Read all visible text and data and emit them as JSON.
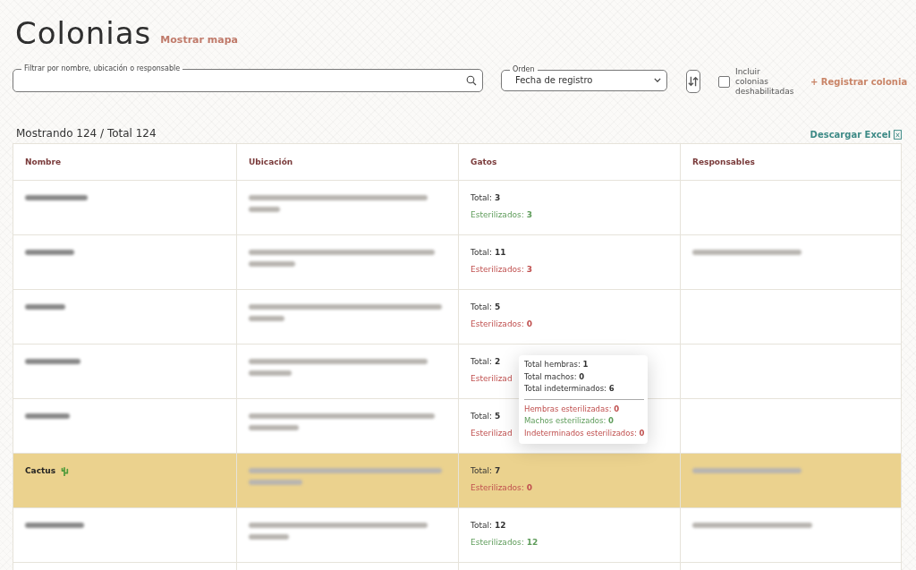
{
  "header": {
    "title": "Colonias",
    "map_link": "Mostrar mapa"
  },
  "filters": {
    "search": {
      "label": "Filtrar por nombre, ubicación o responsable"
    },
    "order": {
      "label": "Orden",
      "value": "Fecha de registro"
    },
    "include_disabled": {
      "label": "Incluir colonias deshabilitadas",
      "checked": false
    },
    "register": "+ Registrar colonia"
  },
  "summary": "Mostrando 124 / Total 124",
  "download": "Descargar Excel",
  "table": {
    "columns": [
      "Nombre",
      "Ubicación",
      "Gatos",
      "Responsables"
    ],
    "rows": [
      {
        "selected": false,
        "name": {
          "kind": "redacted"
        },
        "location": {
          "kind": "redacted"
        },
        "cats": {
          "total_label": "Total:",
          "total": "3",
          "sterilized_label": "Esterilizados:",
          "sterilized": "3",
          "color": "#5e9c5a"
        },
        "owners": {
          "kind": "empty"
        }
      },
      {
        "selected": false,
        "name": {
          "kind": "redacted"
        },
        "location": {
          "kind": "redacted"
        },
        "cats": {
          "total_label": "Total:",
          "total": "11",
          "sterilized_label": "Esterilizados:",
          "sterilized": "3",
          "color": "#c0504f"
        },
        "owners": {
          "kind": "redacted"
        }
      },
      {
        "selected": false,
        "name": {
          "kind": "redacted"
        },
        "location": {
          "kind": "redacted"
        },
        "cats": {
          "total_label": "Total:",
          "total": "5",
          "sterilized_label": "Esterilizados:",
          "sterilized": "0",
          "color": "#c0504f"
        },
        "owners": {
          "kind": "empty"
        }
      },
      {
        "selected": false,
        "name": {
          "kind": "redacted"
        },
        "location": {
          "kind": "redacted"
        },
        "cats": {
          "total_label": "Total:",
          "total": "2",
          "sterilized_label": "Esterilizad",
          "color": "#c0504f"
        },
        "owners": {
          "kind": "empty"
        }
      },
      {
        "selected": false,
        "name": {
          "kind": "redacted"
        },
        "location": {
          "kind": "redacted"
        },
        "cats": {
          "total_label": "Total:",
          "total": "5",
          "sterilized_label": "Esterilizad",
          "color": "#c0504f"
        },
        "owners": {
          "kind": "empty"
        }
      },
      {
        "selected": true,
        "name": {
          "kind": "text",
          "text": "Cactus",
          "plant_icon": true
        },
        "location": {
          "kind": "redacted"
        },
        "cats": {
          "total_label": "Total:",
          "total": "7",
          "sterilized_label": "Esterilizados:",
          "sterilized": "0",
          "color": "#c0504f"
        },
        "owners": {
          "kind": "redacted"
        }
      },
      {
        "selected": false,
        "name": {
          "kind": "redacted"
        },
        "location": {
          "kind": "redacted"
        },
        "cats": {
          "total_label": "Total:",
          "total": "12",
          "sterilized_label": "Esterilizados:",
          "sterilized": "12",
          "color": "#5e9c5a"
        },
        "owners": {
          "kind": "redacted"
        }
      }
    ]
  },
  "tooltip": {
    "totals": [
      {
        "label": "Total hembras:",
        "value": "1"
      },
      {
        "label": "Total machos:",
        "value": "0"
      },
      {
        "label": "Total indeterminados:",
        "value": "6"
      }
    ],
    "sterilized": [
      {
        "label": "Hembras esterilizadas:",
        "value": "0",
        "color": "#c0504f"
      },
      {
        "label": "Machos esterilizados:",
        "value": "0",
        "color": "#5e9c5a"
      },
      {
        "label": "Indeterminados esterilizados:",
        "value": "0",
        "color": "#c0504f"
      }
    ]
  }
}
